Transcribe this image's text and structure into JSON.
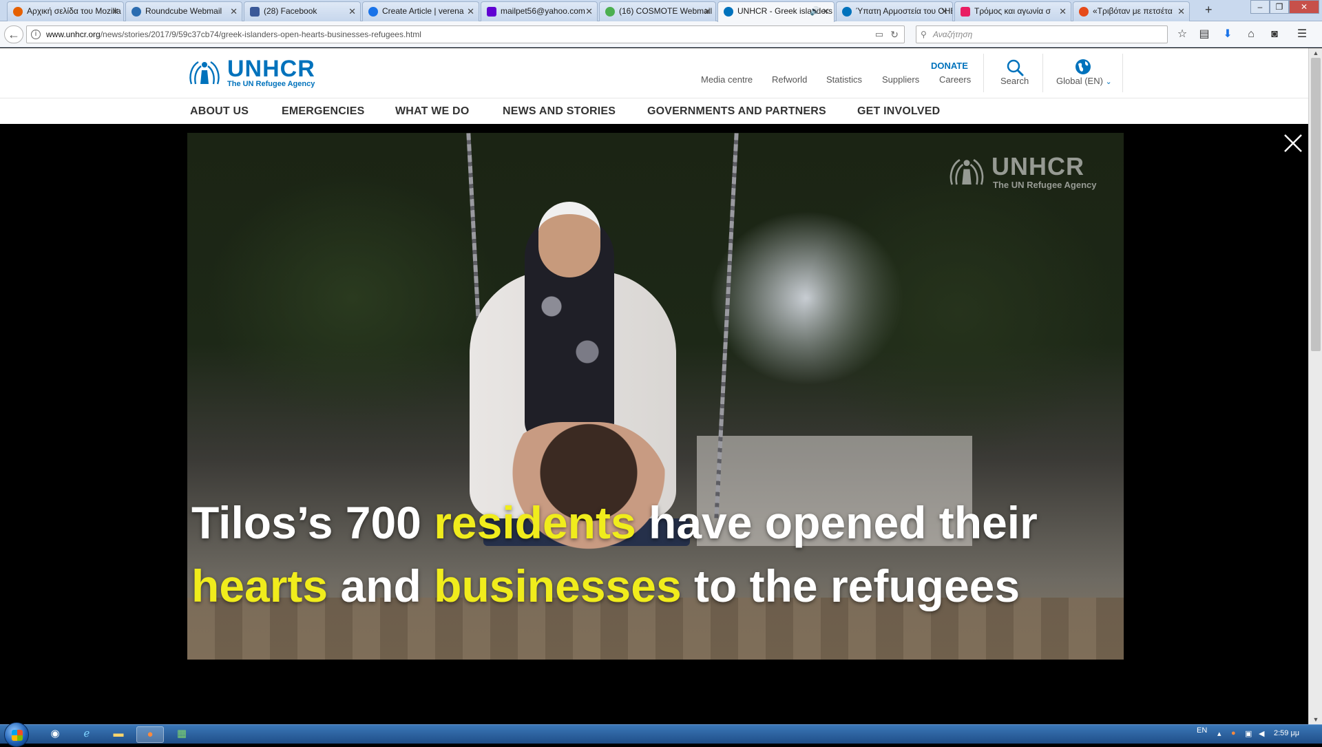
{
  "browser": {
    "tabs": [
      {
        "title": "Αρχική σελίδα του Mozilla",
        "favicon_color": "#e66000"
      },
      {
        "title": "Roundcube Webmail",
        "favicon_color": "#2b6cb0"
      },
      {
        "title": "(28) Facebook",
        "favicon_color": "#3b5998"
      },
      {
        "title": "Create Article | verena",
        "favicon_color": "#1a73e8"
      },
      {
        "title": "mailpet56@yahoo.com",
        "favicon_color": "#6001d2"
      },
      {
        "title": "(16) COSMOTE Webmail",
        "favicon_color": "#4caf50"
      },
      {
        "title": "UNHCR - Greek islanders",
        "favicon_color": "#0072bc",
        "active": true
      },
      {
        "title": "Ύπατη Αρμοστεία του ΟΗΕ",
        "favicon_color": "#0072bc"
      },
      {
        "title": "Τρόμος και αγωνία σ",
        "favicon_color": "#e91e63"
      },
      {
        "title": "«Τριβόταν με πετσέτα",
        "favicon_color": "#e64a19"
      }
    ],
    "new_tab_symbol": "+",
    "window_controls": {
      "minimize": "–",
      "maximize": "❐",
      "close": "✕"
    },
    "url_domain": "www.unhcr.org",
    "url_path": "/news/stories/2017/9/59c37cb74/greek-islanders-open-hearts-businesses-refugees.html",
    "search_placeholder": "Αναζήτηση"
  },
  "site": {
    "logo_word": "UNHCR",
    "logo_tagline": "The UN Refugee Agency",
    "utility_links": [
      "Media centre",
      "Refworld",
      "Statistics",
      "Suppliers",
      "Careers"
    ],
    "donate_label": "DONATE",
    "search_label": "Search",
    "global_label": "Global (EN)",
    "global_chevron": "⌄",
    "main_nav": [
      "ABOUT US",
      "EMERGENCIES",
      "WHAT WE DO",
      "NEWS AND STORIES",
      "GOVERNMENTS AND PARTNERS",
      "GET INVOLVED"
    ],
    "brand_color": "#0072bc"
  },
  "video": {
    "watermark_word": "UNHCR",
    "watermark_tagline": "The UN Refugee Agency",
    "caption_parts": [
      {
        "text": "Tilos’s 700 ",
        "highlight": false
      },
      {
        "text": "residents",
        "highlight": true
      },
      {
        "text": " have opened their",
        "highlight": false
      },
      {
        "text": "hearts",
        "highlight": true
      },
      {
        "text": " and ",
        "highlight": false
      },
      {
        "text": "businesses",
        "highlight": true
      },
      {
        "text": " to the refugees",
        "highlight": false
      }
    ],
    "highlight_color": "#f0ec1c"
  },
  "taskbar": {
    "apps": [
      "chrome-icon",
      "ie-icon",
      "explorer-icon",
      "firefox-icon",
      "paint-icon"
    ],
    "language": "EN",
    "clock": "2:59 μμ"
  }
}
